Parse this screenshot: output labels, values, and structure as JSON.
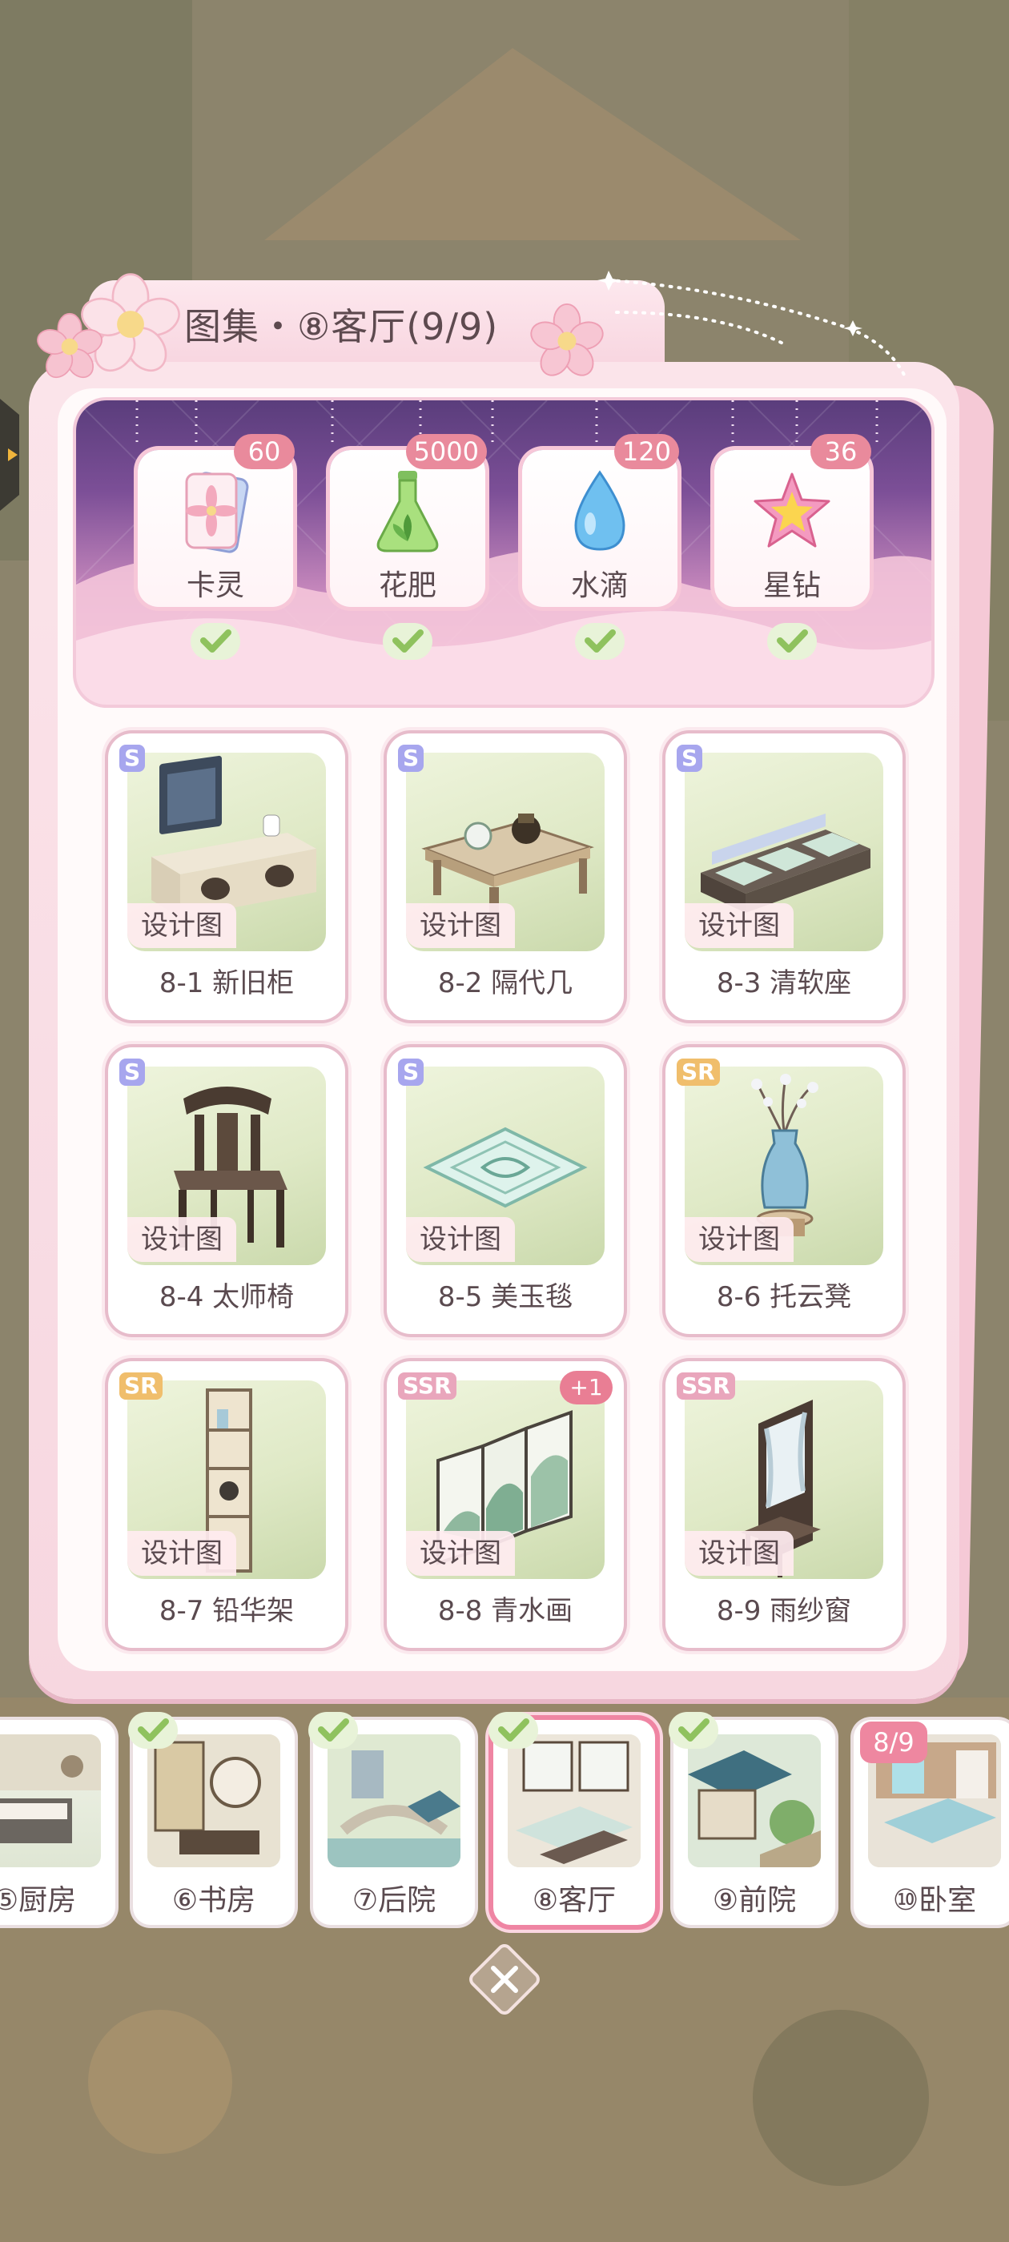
{
  "title": "图集・⑧客厅(9/9)",
  "rewards": [
    {
      "name": "卡灵",
      "count": "60",
      "icon": "card-icon",
      "claimed": true
    },
    {
      "name": "花肥",
      "count": "5000",
      "icon": "fertilizer-flask-icon",
      "claimed": true
    },
    {
      "name": "水滴",
      "count": "120",
      "icon": "water-drop-icon",
      "claimed": true
    },
    {
      "name": "星钻",
      "count": "36",
      "icon": "star-diamond-icon",
      "claimed": true
    }
  ],
  "tag_label": "设计图",
  "items": [
    {
      "name": "8-1 新旧柜",
      "rarity": "S",
      "icon": "tv-cabinet-icon"
    },
    {
      "name": "8-2 隔代几",
      "rarity": "S",
      "icon": "tea-table-icon"
    },
    {
      "name": "8-3 清软座",
      "rarity": "S",
      "icon": "sofa-icon"
    },
    {
      "name": "8-4 太师椅",
      "rarity": "S",
      "icon": "armchair-icon"
    },
    {
      "name": "8-5 美玉毯",
      "rarity": "S",
      "icon": "jade-rug-icon"
    },
    {
      "name": "8-6 托云凳",
      "rarity": "SR",
      "icon": "vase-stool-icon"
    },
    {
      "name": "8-7 铅华架",
      "rarity": "SR",
      "icon": "shelf-icon"
    },
    {
      "name": "8-8 青水画",
      "rarity": "SSR",
      "icon": "landscape-screen-icon",
      "extra": "+1"
    },
    {
      "name": "8-9 雨纱窗",
      "rarity": "SSR",
      "icon": "curtain-window-icon"
    }
  ],
  "rooms": [
    {
      "label": "⑤厨房",
      "checked": false
    },
    {
      "label": "⑥书房",
      "checked": true
    },
    {
      "label": "⑦后院",
      "checked": true
    },
    {
      "label": "⑧客厅",
      "checked": true,
      "active": true
    },
    {
      "label": "⑨前院",
      "checked": true
    },
    {
      "label": "⑩卧室",
      "checked": false,
      "progress": "8/9"
    }
  ],
  "colors": {
    "accent_pink": "#e98a9c",
    "banner_purple": "#5a3d7c",
    "check_green": "#9cc86a"
  }
}
